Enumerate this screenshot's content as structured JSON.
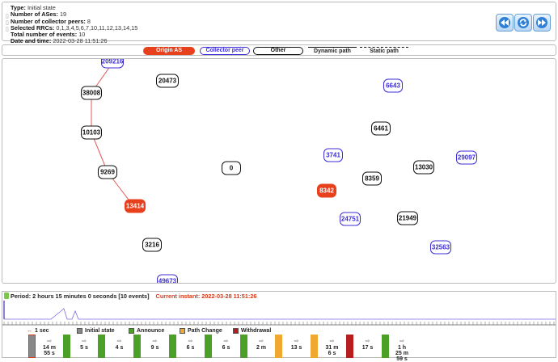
{
  "info": {
    "type_label": "Type:",
    "type_value": "Initial state",
    "ases_label": "Number of ASes:",
    "ases_value": "19",
    "collectors_label": "Number of collector peers:",
    "collectors_value": "8",
    "rrcs_label": "Selected RRCs:",
    "rrcs_value": "0,1,3,4,5,6,7,10,11,12,13,14,15",
    "events_label": "Total number of events:",
    "events_value": "10",
    "date_label": "Date and time:",
    "date_value": "2022-03-28 11:51:26"
  },
  "legend": {
    "origin": "Origin AS",
    "collector": "Collector peer",
    "other": "Other",
    "dynamic": "Dynamic path",
    "static": "Static path"
  },
  "colors": {
    "origin": "#e8401c",
    "collector": "#3c2dd6",
    "other": "#111111",
    "path": "#e35a5a",
    "initial": "#888888",
    "announce": "#4ca028",
    "path_change": "#f0a830",
    "withdrawal": "#b81c1c"
  },
  "nodes": [
    {
      "id": "209216",
      "kind": "collector"
    },
    {
      "id": "38008",
      "kind": "other"
    },
    {
      "id": "20473",
      "kind": "other"
    },
    {
      "id": "10103",
      "kind": "other"
    },
    {
      "id": "9269",
      "kind": "other"
    },
    {
      "id": "13414",
      "kind": "origin"
    },
    {
      "id": "0",
      "kind": "other"
    },
    {
      "id": "3216",
      "kind": "other"
    },
    {
      "id": "49673",
      "kind": "collector"
    },
    {
      "id": "6643",
      "kind": "collector"
    },
    {
      "id": "6461",
      "kind": "other"
    },
    {
      "id": "3741",
      "kind": "collector"
    },
    {
      "id": "29097",
      "kind": "collector"
    },
    {
      "id": "8359",
      "kind": "other"
    },
    {
      "id": "13030",
      "kind": "other"
    },
    {
      "id": "8342",
      "kind": "origin"
    },
    {
      "id": "24751",
      "kind": "collector"
    },
    {
      "id": "21949",
      "kind": "other"
    },
    {
      "id": "32563",
      "kind": "collector"
    }
  ],
  "timeline": {
    "period_text": "Period: 2 hours 15 minutes 0 seconds [10 events]",
    "current_text": "Current instant: 2022-03-28 11:51:26",
    "scale_label": "1 sec",
    "legend": {
      "initial": "Initial state",
      "announce": "Announce",
      "path_change": "Path Change",
      "withdrawal": "Withdrawal"
    },
    "events": [
      {
        "kind": "initial"
      },
      {
        "kind": "announce"
      },
      {
        "kind": "announce"
      },
      {
        "kind": "announce"
      },
      {
        "kind": "announce"
      },
      {
        "kind": "announce"
      },
      {
        "kind": "announce"
      },
      {
        "kind": "path_change"
      },
      {
        "kind": "path_change"
      },
      {
        "kind": "withdrawal"
      },
      {
        "kind": "announce"
      }
    ],
    "gaps": [
      "14 m\n55 s",
      "5 s",
      "4 s",
      "9 s",
      "6 s",
      "6 s",
      "2 m",
      "13 s",
      "31 m\n6 s",
      "17 s",
      "1 h\n25 m\n59 s"
    ]
  }
}
